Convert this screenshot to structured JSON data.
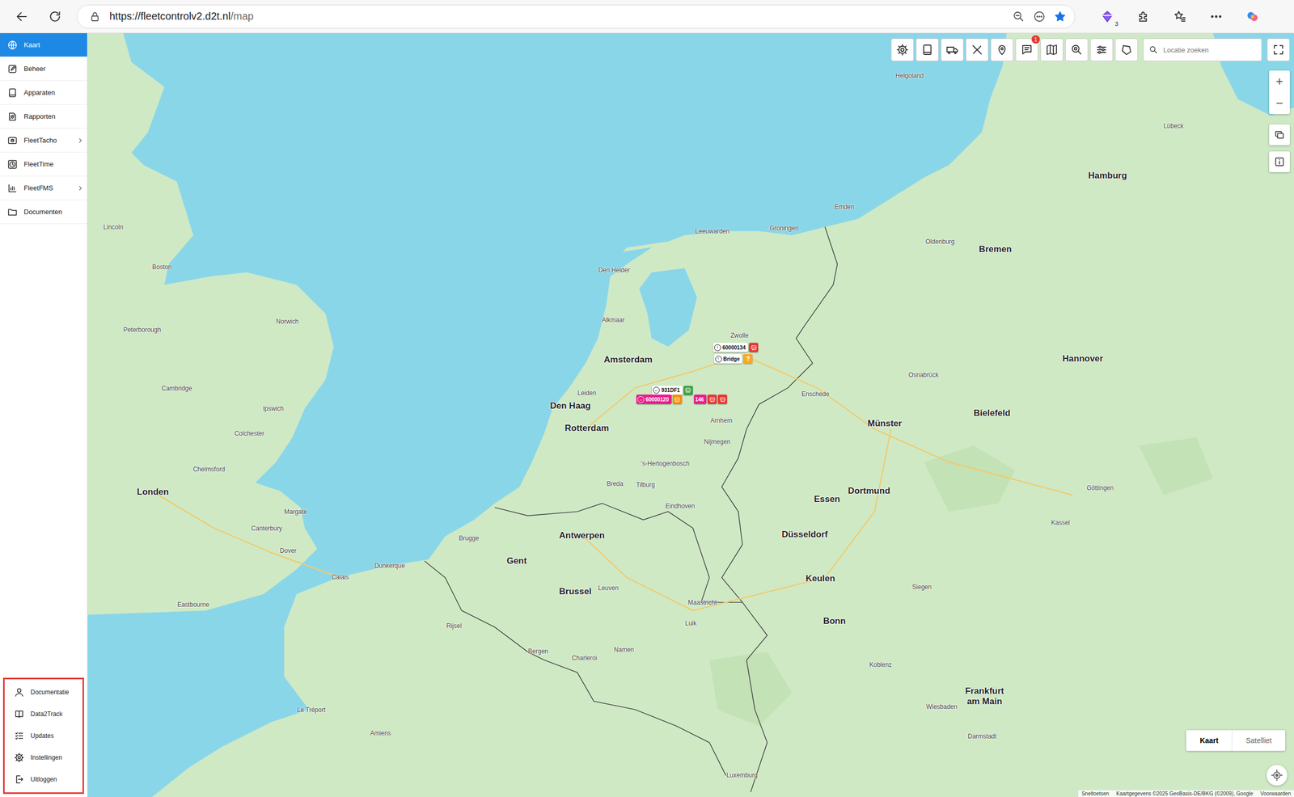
{
  "browser": {
    "url_host": "https://fleetcontrolv2.d2t.nl",
    "url_path": "/map",
    "bookmarked": true,
    "extension_badge": "3"
  },
  "sidebar": {
    "items": [
      {
        "label": "Kaart",
        "selected": true,
        "expandable": false
      },
      {
        "label": "Beheer",
        "selected": false,
        "expandable": false
      },
      {
        "label": "Apparaten",
        "selected": false,
        "expandable": false
      },
      {
        "label": "Rapporten",
        "selected": false,
        "expandable": false
      },
      {
        "label": "FleetTacho",
        "selected": false,
        "expandable": true
      },
      {
        "label": "FleetTime",
        "selected": false,
        "expandable": false
      },
      {
        "label": "FleetFMS",
        "selected": false,
        "expandable": true
      },
      {
        "label": "Documenten",
        "selected": false,
        "expandable": false
      }
    ],
    "footer_items": [
      "Documentatie",
      "Data2Track",
      "Updates",
      "Instellingen",
      "Uitloggen"
    ],
    "footer_highlighted": true
  },
  "map_toolbar": {
    "notification_badge": "1",
    "search": {
      "placeholder": "Locatie zoeken"
    }
  },
  "zoom": {
    "in": "+",
    "out": "−"
  },
  "map_type": [
    {
      "label": "Kaart",
      "selected": true
    },
    {
      "label": "Satelliet",
      "selected": false
    }
  ],
  "attribution": [
    "Sneltoetsen",
    "Kaartgegevens ©2025 GeoBasis-DE/BKG (©2009), Google",
    "Voorwaarden"
  ],
  "map": {
    "labels": [
      "Amsterdam",
      "Den Haag",
      "Rotterdam",
      "Zwolle",
      "Groningen",
      "Leeuwarden",
      "Den Helder",
      "Alkmaar",
      "Leiden",
      "Arnhem",
      "Nijmegen",
      "Enschede",
      "Eindhoven",
      "Breda",
      "Tilburg",
      "'s-Hertogenbosch",
      "Antwerpen",
      "Gent",
      "Brussel",
      "Brugge",
      "Leuven",
      "Maastricht",
      "Luik",
      "Namen",
      "Charleroi",
      "Bergen",
      "Luxemburg",
      "Düsseldorf",
      "Essen",
      "Dortmund",
      "Keulen",
      "Bonn",
      "Münster",
      "Bielefeld",
      "Osnabrück",
      "Hannover",
      "Bremen",
      "Hamburg",
      "Oldenburg",
      "Emden",
      "Helgoland",
      "Lübeck",
      "Kassel",
      "Siegen",
      "Koblenz",
      "Wiesbaden",
      "Frankfurt am Main",
      "Darmstadt",
      "Göttingen",
      "Londen",
      "Norwich",
      "Ipswich",
      "Cambridge",
      "Colchester",
      "Chelmsford",
      "Calais",
      "Dunkerque",
      "Rijsel",
      "Amiens",
      "Le Tréport",
      "Peterborough",
      "Lincoln",
      "Margate",
      "Canterbury",
      "Dover",
      "Eastbourne",
      "Boston"
    ]
  },
  "vehicles": [
    {
      "label": "60000134",
      "arrow": "↑",
      "color": "#ffffff",
      "text_color": "#111111",
      "icons": [
        "#e53935"
      ]
    },
    {
      "label": "Bridge",
      "arrow": "↑",
      "color": "#ffffff",
      "text_color": "#111111",
      "icons": [
        "#f9a825"
      ],
      "badge": "?"
    },
    {
      "label": "931DF1",
      "arrow": "←",
      "color": "#ffffff",
      "text_color": "#111111",
      "icons": [
        "#43a047"
      ]
    },
    {
      "label": "60000120",
      "arrow": "→",
      "color": "#e91e8c",
      "text_color": "#ffffff",
      "icons": [
        "#fb8c00"
      ]
    },
    {
      "label": "146",
      "color": "#e91e8c",
      "text_color": "#ffffff",
      "icons": [
        "#e53935",
        "#e53935"
      ]
    }
  ]
}
